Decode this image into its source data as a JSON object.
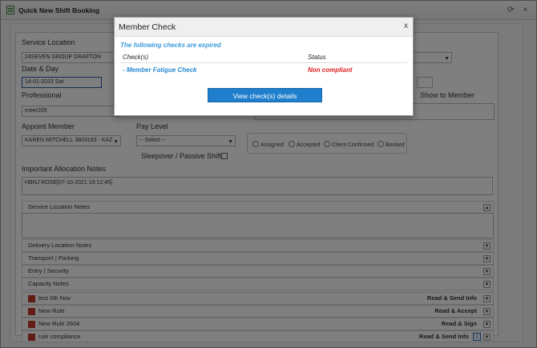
{
  "window": {
    "title": "Quick New Shift Booking",
    "refresh_glyph": "⟳",
    "close_glyph": "×"
  },
  "form": {
    "service_location_label": "Service Location",
    "service_location_value": "24SEVEN GROUP GRAFTON",
    "date_day_label": "Date & Day",
    "date_value": "14-01-2023 Sat",
    "professional_label": "Professional",
    "professional_value": "meer205",
    "show_to_member_label": "Show to Member",
    "appoint_member_label": "Appoint Member",
    "appoint_member_value": "KAREN MITCHELL 3803183 - KAZ",
    "pay_level_label": "Pay Level",
    "pay_level_placeholder": "-- Select --",
    "status_options": [
      "Assigned",
      "Accepted",
      "Client Confirmed",
      "Booked"
    ],
    "sleepover_label": "Sleepover / Passive Shift?",
    "allocation_notes_label": "Important Allocation Notes",
    "allocation_notes_value": "HBNJ ROSE[07-10-2021 15:12:45]"
  },
  "sections": [
    "Service Location Notes",
    "Delivery Location Notes",
    "Transport | Parking",
    "Entry | Security",
    "Capacity Notes"
  ],
  "rules": [
    {
      "name": "test 5th Nov",
      "action": "Read & Send Info"
    },
    {
      "name": "New Rule",
      "action": "Read & Accept"
    },
    {
      "name": "New Rule 2604",
      "action": "Read & Sign"
    },
    {
      "name": "rule compliance",
      "action": "Read & Send Info"
    }
  ],
  "modal": {
    "title": "Member Check",
    "close_label": "x",
    "expired_message": "The following checks are expired",
    "col_check": "Check(s)",
    "col_status": "Status",
    "row_check": "- Member Fatigue Check",
    "row_status": "Non compliant",
    "button_label": "View check(s) details"
  },
  "colors": {
    "primary_button": "#1f7fcc",
    "status_error": "#e02020",
    "link_blue": "#2a8ad0",
    "rule_marker": "#c0392b"
  }
}
